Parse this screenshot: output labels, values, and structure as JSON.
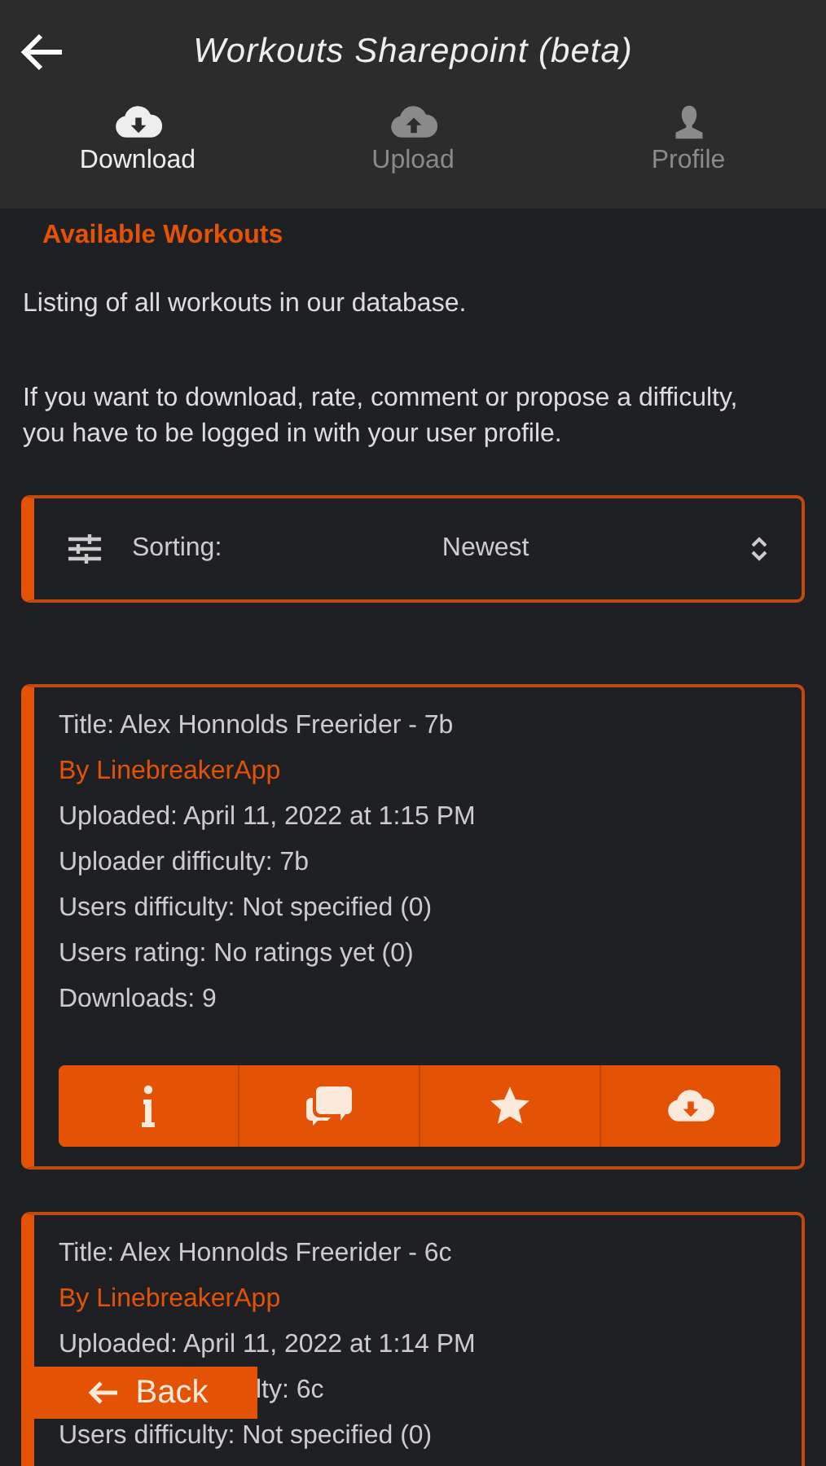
{
  "header": {
    "title": "Workouts Sharepoint (beta)"
  },
  "tabs": [
    {
      "label": "Download",
      "selected": true
    },
    {
      "label": "Upload",
      "selected": false
    },
    {
      "label": "Profile",
      "selected": false
    }
  ],
  "section_title": "Available Workouts",
  "intro": [
    "Listing of all workouts in our database.",
    "If you want to download, rate, comment or propose a difficulty, you have to be logged in with your user profile."
  ],
  "sorting": {
    "label": "Sorting:",
    "value": "Newest"
  },
  "workouts": [
    {
      "lines": [
        {
          "kind": "plain",
          "text": "Title: Alex Honnolds Freerider - 7b"
        },
        {
          "kind": "author",
          "text": "By LinebreakerApp"
        },
        {
          "kind": "plain",
          "text": "Uploaded: April 11, 2022 at 1:15 PM"
        },
        {
          "kind": "plain",
          "text": "Uploader difficulty: 7b"
        },
        {
          "kind": "plain",
          "text": "Users difficulty: Not specified (0)"
        },
        {
          "kind": "plain",
          "text": "Users rating: No ratings yet (0)"
        },
        {
          "kind": "plain",
          "text": "Downloads: 9"
        }
      ],
      "kind": "full"
    },
    {
      "lines": [
        {
          "kind": "plain",
          "text": "Title: Alex Honnolds Freerider - 6c"
        },
        {
          "kind": "author",
          "text": "By LinebreakerApp"
        },
        {
          "kind": "plain",
          "text": "Uploaded: April 11, 2022 at 1:14 PM"
        },
        {
          "kind": "covered",
          "text": "lty: 6c"
        },
        {
          "kind": "plain",
          "text": "Users difficulty: Not specified (0)"
        }
      ],
      "kind": "cut"
    }
  ],
  "back_button": {
    "label": "Back"
  }
}
